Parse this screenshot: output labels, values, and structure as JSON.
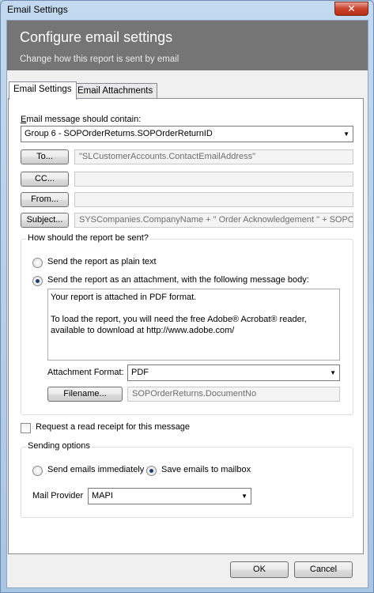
{
  "window": {
    "title": "Email Settings",
    "close_glyph": "✕"
  },
  "header": {
    "title": "Configure email settings",
    "subtitle": "Change how this report is sent by email"
  },
  "tabs": [
    {
      "label": "Email Settings",
      "active": true
    },
    {
      "label": "Email Attachments",
      "active": false
    }
  ],
  "contents": {
    "label": "Email message should contain:",
    "selected": "Group 6 - SOPOrderReturns.SOPOrderReturnID"
  },
  "recipients": {
    "to_label": "To...",
    "to_value": "\"SLCustomerAccounts.ContactEmailAddress\"",
    "cc_label": "CC...",
    "cc_value": "",
    "from_label": "From...",
    "from_value": "",
    "subject_label": "Subject...",
    "subject_value": "SYSCompanies.CompanyName  + \" Order Acknowledgement  \" + SOPOrd"
  },
  "send_method": {
    "group_title": "How should the report be sent?",
    "plain_text_label": "Send the report as plain text",
    "attachment_label": "Send the report as an attachment, with the following message body:",
    "selected": "attachment",
    "body_line1": "Your report is attached in PDF format.",
    "body_line2": "To load the report, you will need the free Adobe® Acrobat® reader, available to download at http://www.adobe.com/",
    "format_label": "Attachment Format:",
    "format_value": "PDF",
    "filename_label": "Filename...",
    "filename_value": "SOPOrderReturns.DocumentNo"
  },
  "read_receipt": {
    "label": "Request a read receipt for this message",
    "checked": false
  },
  "sending_options": {
    "group_title": "Sending options",
    "immediately_label": "Send emails immediately",
    "mailbox_label": "Save emails to mailbox",
    "selected": "mailbox",
    "provider_label": "Mail Provider",
    "provider_value": "MAPI"
  },
  "footer": {
    "ok_label": "OK",
    "cancel_label": "Cancel"
  },
  "icons": {
    "dropdown": "chevron-down-icon",
    "close": "close-icon"
  }
}
